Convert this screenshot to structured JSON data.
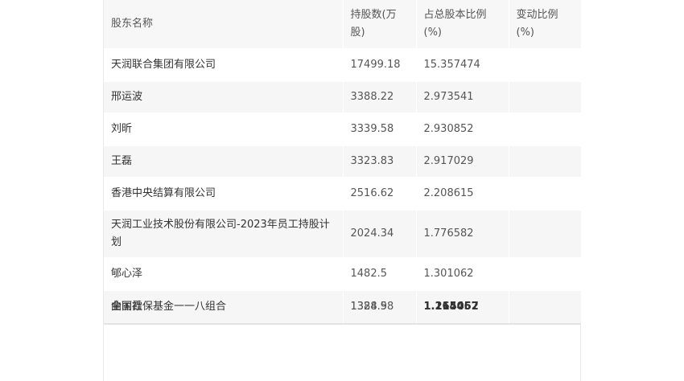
{
  "table": {
    "headers": [
      "股东名称",
      "持股数(万股)",
      "占总股本比例(%)",
      "变动比例(%)"
    ],
    "rows": [
      {
        "name": "天润联合集团有限公司",
        "shares": "17499.18",
        "ratio": "15.357474",
        "change": ""
      },
      {
        "name": "邢运波",
        "shares": "3388.22",
        "ratio": "2.973541",
        "change": ""
      },
      {
        "name": "刘昕",
        "shares": "3339.58",
        "ratio": "2.930852",
        "change": ""
      },
      {
        "name": "王磊",
        "shares": "3323.83",
        "ratio": "2.917029",
        "change": ""
      },
      {
        "name": "香港中央结算有限公司",
        "shares": "2516.62",
        "ratio": "2.208615",
        "change": ""
      },
      {
        "name": "天润工业技术股份有限公司-2023年员工持股计划",
        "shares": "2024.34",
        "ratio": "1.776582",
        "change": ""
      },
      {
        "name": "郇心泽",
        "shares": "1482.5",
        "ratio": "1.301062",
        "change": ""
      }
    ],
    "last_row": {
      "name_a": "全国社保基金一一八组合",
      "name_b": "曲丽霞",
      "shares_a": "1384.98",
      "shares_b": "1328.5",
      "ratio_a": "1.214062",
      "ratio_b": "1.165457",
      "change": ""
    }
  }
}
